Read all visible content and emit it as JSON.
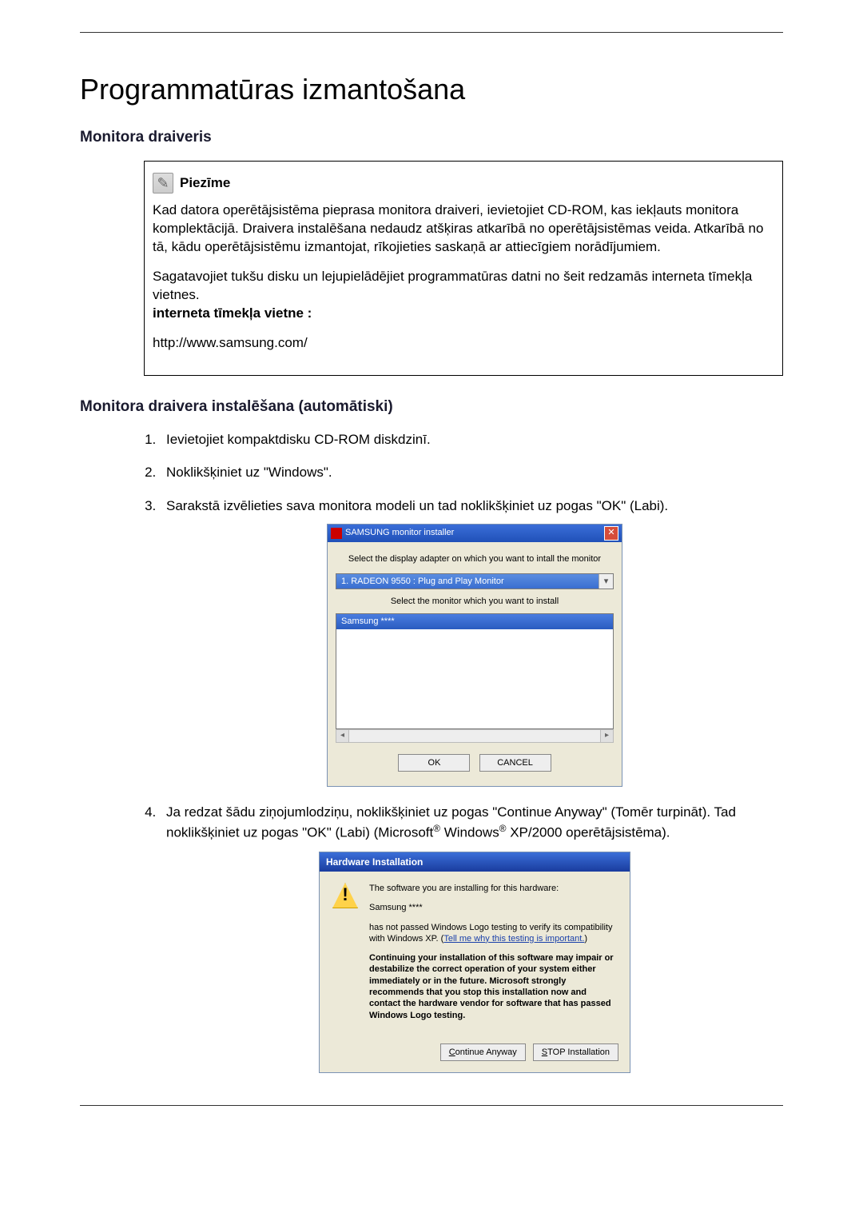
{
  "page": {
    "title": "Programmatūras izmantošana",
    "section1": "Monitora draiveris",
    "section2": "Monitora draivera instalēšana (automātiski)"
  },
  "note": {
    "title": "Piezīme",
    "para1": "Kad datora operētājsistēma pieprasa monitora draiveri, ievietojiet CD-ROM, kas iekļauts monitora komplektācijā. Draivera instalēšana nedaudz atšķiras atkarībā no operētājsistēmas veida. Atkarībā no tā, kādu operētājsistēmu izmantojat, rīkojieties saskaņā ar attiecīgiem norādījumiem.",
    "para2": "Sagatavojiet tukšu disku un lejupielādējiet programmatūras datni no šeit redzamās interneta tīmekļa vietnes.",
    "label": "interneta tīmekļa vietne :",
    "url": "http://www.samsung.com/"
  },
  "steps": {
    "s1": "Ievietojiet kompaktdisku CD-ROM diskdzinī.",
    "s2": "Noklikšķiniet uz \"Windows\".",
    "s3": "Sarakstā izvēlieties sava monitora modeli un tad noklikšķiniet uz pogas \"OK\" (Labi).",
    "s4_a": "Ja redzat šādu ziņojumlodziņu, noklikšķiniet uz pogas \"Continue Anyway\" (Tomēr turpināt). Tad noklikšķiniet uz pogas \"OK\" (Labi) (Microsoft",
    "s4_b": " Windows",
    "s4_c": " XP/2000 operētājsistēma)."
  },
  "installer": {
    "title": "SAMSUNG monitor installer",
    "instr1": "Select the display adapter on which you want to intall the monitor",
    "adapter": "1. RADEON 9550 : Plug and Play Monitor",
    "instr2": "Select the monitor which you want to install",
    "selected": "Samsung ****",
    "ok": "OK",
    "cancel": "CANCEL"
  },
  "hw": {
    "title": "Hardware Installation",
    "line1": "The software you are installing for this hardware:",
    "line2": "Samsung ****",
    "line3a": "has not passed Windows Logo testing to verify its compatibility with Windows XP. (",
    "link": "Tell me why this testing is important.",
    "line3b": ")",
    "bold": "Continuing your installation of this software may impair or destabilize the correct operation of your system either immediately or in the future. Microsoft strongly recommends that you stop this installation now and contact the hardware vendor for software that has passed Windows Logo testing.",
    "btn_cont_prefix": "C",
    "btn_cont_rest": "ontinue Anyway",
    "btn_stop_prefix": "S",
    "btn_stop_rest": "TOP Installation"
  }
}
